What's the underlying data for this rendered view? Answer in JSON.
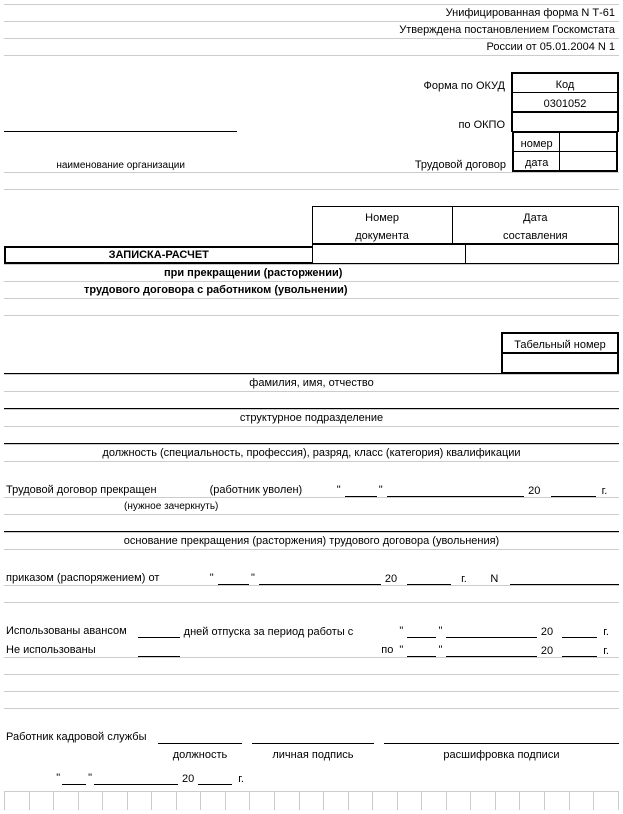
{
  "header": {
    "line1": "Унифицированная форма N Т-61",
    "line2": "Утверждена постановлением Госкомстата",
    "line3": "России от 05.01.2004 N 1"
  },
  "codes": {
    "code_hdr": "Код",
    "okud_lbl": "Форма по ОКУД",
    "okud_val": "0301052",
    "okpo_lbl": "по ОКПО",
    "okpo_val": "",
    "number_lbl": "номер",
    "number_val": "",
    "date_lbl": "дата",
    "date_val": ""
  },
  "org_caption": "наименование организации",
  "contract_caption": "Трудовой договор",
  "docbox": {
    "num_lbl1": "Номер",
    "num_lbl2": "документа",
    "date_lbl1": "Дата",
    "date_lbl2": "составления",
    "num_val": "",
    "date_val": ""
  },
  "title": "ЗАПИСКА-РАСЧЕТ",
  "subtitle1": "при прекращении (расторжении)",
  "subtitle2": "трудового договора с работником (увольнении)",
  "tab_num": "Табельный номер",
  "fio": "фамилия, имя, отчество",
  "dept": "структурное подразделение",
  "position": "должность (специальность, профессия), разряд, класс (категория) квалификации",
  "terminate": {
    "text1": "Трудовой договор прекращен",
    "text2": "(работник уволен)",
    "year_lbl": "20",
    "year_suffix": "г.",
    "note": "(нужное зачеркнуть)"
  },
  "basis": "основание прекращения (расторжения) трудового договора (увольнения)",
  "order": {
    "prefix": "приказом (распоряжением) от",
    "year_lbl": "20",
    "year_suffix": "г.",
    "n_lbl": "N"
  },
  "vacation": {
    "used": "Использованы авансом",
    "not_used": "Не использованы",
    "days_label": "дней отпуска за период работы с",
    "to_label": "по",
    "year_lbl": "20",
    "year_suffix": "г."
  },
  "hr": {
    "title": "Работник кадровой службы",
    "cap_position": "должность",
    "cap_sign": "личная подпись",
    "cap_decipher": "расшифровка подписи",
    "year_lbl": "20",
    "year_suffix": "г."
  }
}
